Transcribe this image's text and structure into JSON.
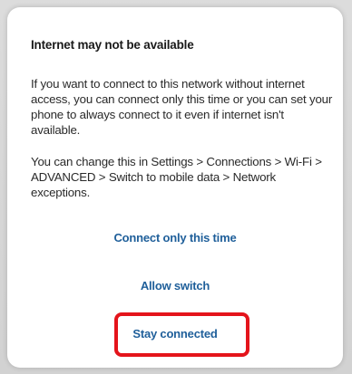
{
  "dialog": {
    "title": "Internet may not be available",
    "paragraph1": "If you want to connect to this network without internet access, you can connect only this time or you can set your phone to always connect to it even if internet isn't available.",
    "paragraph2": "You can change this in Settings > Connections > Wi-Fi > ADVANCED > Switch to mobile data > Network exceptions.",
    "actions": {
      "connect_once": "Connect only this time",
      "allow_switch": "Allow switch",
      "stay_connected": "Stay connected"
    }
  },
  "colors": {
    "action_text": "#1f5f9a",
    "highlight": "#e4141b"
  }
}
